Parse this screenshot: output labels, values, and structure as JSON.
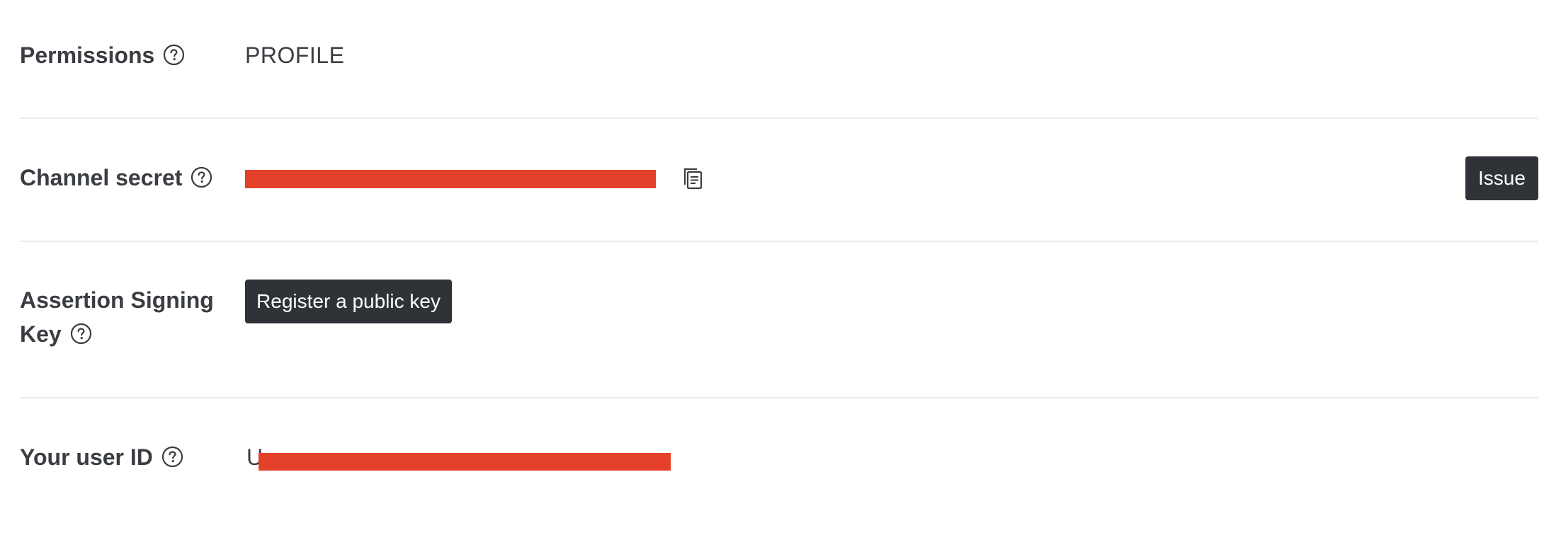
{
  "permissions": {
    "label": "Permissions",
    "value": "PROFILE"
  },
  "channel_secret": {
    "label": "Channel secret",
    "issue_label": "Issue"
  },
  "assertion_key": {
    "label_line1": "Assertion Signing",
    "label_line2": "Key",
    "register_label": "Register a public key"
  },
  "user_id": {
    "label": "Your user ID",
    "value_prefix": "U"
  },
  "colors": {
    "text": "#3a3d42",
    "button_bg": "#2f3337",
    "redaction": "#e5402a",
    "divider": "#ebebeb"
  },
  "icons": {
    "help": "question-circle-icon",
    "copy": "copy-icon"
  }
}
